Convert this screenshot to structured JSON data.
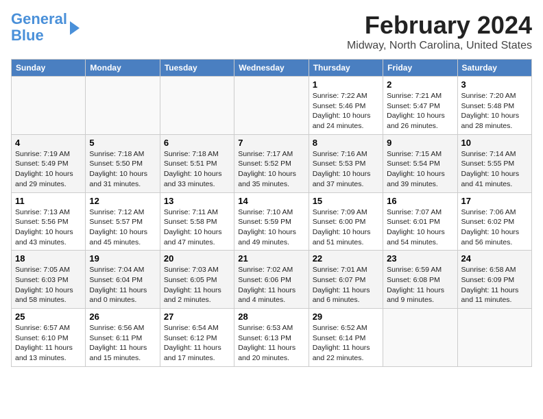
{
  "logo": {
    "line1": "General",
    "line2": "Blue"
  },
  "title": "February 2024",
  "subtitle": "Midway, North Carolina, United States",
  "columns": [
    "Sunday",
    "Monday",
    "Tuesday",
    "Wednesday",
    "Thursday",
    "Friday",
    "Saturday"
  ],
  "weeks": [
    [
      {
        "num": "",
        "info": ""
      },
      {
        "num": "",
        "info": ""
      },
      {
        "num": "",
        "info": ""
      },
      {
        "num": "",
        "info": ""
      },
      {
        "num": "1",
        "info": "Sunrise: 7:22 AM\nSunset: 5:46 PM\nDaylight: 10 hours\nand 24 minutes."
      },
      {
        "num": "2",
        "info": "Sunrise: 7:21 AM\nSunset: 5:47 PM\nDaylight: 10 hours\nand 26 minutes."
      },
      {
        "num": "3",
        "info": "Sunrise: 7:20 AM\nSunset: 5:48 PM\nDaylight: 10 hours\nand 28 minutes."
      }
    ],
    [
      {
        "num": "4",
        "info": "Sunrise: 7:19 AM\nSunset: 5:49 PM\nDaylight: 10 hours\nand 29 minutes."
      },
      {
        "num": "5",
        "info": "Sunrise: 7:18 AM\nSunset: 5:50 PM\nDaylight: 10 hours\nand 31 minutes."
      },
      {
        "num": "6",
        "info": "Sunrise: 7:18 AM\nSunset: 5:51 PM\nDaylight: 10 hours\nand 33 minutes."
      },
      {
        "num": "7",
        "info": "Sunrise: 7:17 AM\nSunset: 5:52 PM\nDaylight: 10 hours\nand 35 minutes."
      },
      {
        "num": "8",
        "info": "Sunrise: 7:16 AM\nSunset: 5:53 PM\nDaylight: 10 hours\nand 37 minutes."
      },
      {
        "num": "9",
        "info": "Sunrise: 7:15 AM\nSunset: 5:54 PM\nDaylight: 10 hours\nand 39 minutes."
      },
      {
        "num": "10",
        "info": "Sunrise: 7:14 AM\nSunset: 5:55 PM\nDaylight: 10 hours\nand 41 minutes."
      }
    ],
    [
      {
        "num": "11",
        "info": "Sunrise: 7:13 AM\nSunset: 5:56 PM\nDaylight: 10 hours\nand 43 minutes."
      },
      {
        "num": "12",
        "info": "Sunrise: 7:12 AM\nSunset: 5:57 PM\nDaylight: 10 hours\nand 45 minutes."
      },
      {
        "num": "13",
        "info": "Sunrise: 7:11 AM\nSunset: 5:58 PM\nDaylight: 10 hours\nand 47 minutes."
      },
      {
        "num": "14",
        "info": "Sunrise: 7:10 AM\nSunset: 5:59 PM\nDaylight: 10 hours\nand 49 minutes."
      },
      {
        "num": "15",
        "info": "Sunrise: 7:09 AM\nSunset: 6:00 PM\nDaylight: 10 hours\nand 51 minutes."
      },
      {
        "num": "16",
        "info": "Sunrise: 7:07 AM\nSunset: 6:01 PM\nDaylight: 10 hours\nand 54 minutes."
      },
      {
        "num": "17",
        "info": "Sunrise: 7:06 AM\nSunset: 6:02 PM\nDaylight: 10 hours\nand 56 minutes."
      }
    ],
    [
      {
        "num": "18",
        "info": "Sunrise: 7:05 AM\nSunset: 6:03 PM\nDaylight: 10 hours\nand 58 minutes."
      },
      {
        "num": "19",
        "info": "Sunrise: 7:04 AM\nSunset: 6:04 PM\nDaylight: 11 hours\nand 0 minutes."
      },
      {
        "num": "20",
        "info": "Sunrise: 7:03 AM\nSunset: 6:05 PM\nDaylight: 11 hours\nand 2 minutes."
      },
      {
        "num": "21",
        "info": "Sunrise: 7:02 AM\nSunset: 6:06 PM\nDaylight: 11 hours\nand 4 minutes."
      },
      {
        "num": "22",
        "info": "Sunrise: 7:01 AM\nSunset: 6:07 PM\nDaylight: 11 hours\nand 6 minutes."
      },
      {
        "num": "23",
        "info": "Sunrise: 6:59 AM\nSunset: 6:08 PM\nDaylight: 11 hours\nand 9 minutes."
      },
      {
        "num": "24",
        "info": "Sunrise: 6:58 AM\nSunset: 6:09 PM\nDaylight: 11 hours\nand 11 minutes."
      }
    ],
    [
      {
        "num": "25",
        "info": "Sunrise: 6:57 AM\nSunset: 6:10 PM\nDaylight: 11 hours\nand 13 minutes."
      },
      {
        "num": "26",
        "info": "Sunrise: 6:56 AM\nSunset: 6:11 PM\nDaylight: 11 hours\nand 15 minutes."
      },
      {
        "num": "27",
        "info": "Sunrise: 6:54 AM\nSunset: 6:12 PM\nDaylight: 11 hours\nand 17 minutes."
      },
      {
        "num": "28",
        "info": "Sunrise: 6:53 AM\nSunset: 6:13 PM\nDaylight: 11 hours\nand 20 minutes."
      },
      {
        "num": "29",
        "info": "Sunrise: 6:52 AM\nSunset: 6:14 PM\nDaylight: 11 hours\nand 22 minutes."
      },
      {
        "num": "",
        "info": ""
      },
      {
        "num": "",
        "info": ""
      }
    ]
  ]
}
